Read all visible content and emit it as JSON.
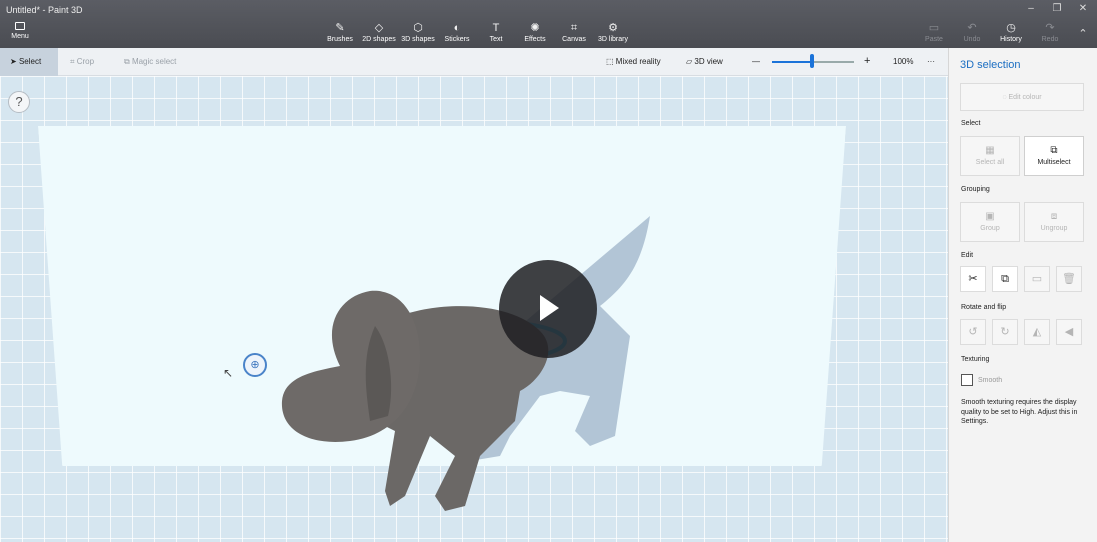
{
  "window": {
    "title": "Untitled* - Paint 3D",
    "minimize": "–",
    "maximize": "❐",
    "close": "✕"
  },
  "ribbon": {
    "menu": {
      "icon": "folder-icon",
      "label": "Menu"
    },
    "tools": [
      {
        "label": "Brushes",
        "icon": "✎"
      },
      {
        "label": "2D shapes",
        "icon": "◇"
      },
      {
        "label": "3D shapes",
        "icon": "⬡"
      },
      {
        "label": "Stickers",
        "icon": "◐"
      },
      {
        "label": "Text",
        "icon": "T"
      },
      {
        "label": "Effects",
        "icon": "✺"
      },
      {
        "label": "Canvas",
        "icon": "⌗"
      },
      {
        "label": "3D library",
        "icon": "⚙"
      }
    ],
    "right": [
      {
        "label": "Paste",
        "icon": "📋",
        "enabled": false
      },
      {
        "label": "Undo",
        "icon": "↶",
        "enabled": false
      },
      {
        "label": "History",
        "icon": "🕘",
        "enabled": true
      },
      {
        "label": "Redo",
        "icon": "↷",
        "enabled": false
      }
    ],
    "collapse_icon": "⌃"
  },
  "toolbar": {
    "select": "Select",
    "crop": "Crop",
    "magic": "Magic select",
    "mixed": "Mixed reality",
    "view3d": "3D view",
    "zoom_minus": "—",
    "zoom_plus": "+",
    "zoom": "100%",
    "more": "···"
  },
  "canvas": {
    "help": "?"
  },
  "panel": {
    "title": "3D selection",
    "edit_colour": "Edit colour",
    "select": {
      "heading": "Select",
      "select_all": "Select all",
      "multiselect": "Multiselect"
    },
    "grouping": {
      "heading": "Grouping",
      "group": "Group",
      "ungroup": "Ungroup"
    },
    "edit": {
      "heading": "Edit"
    },
    "rotate": {
      "heading": "Rotate and flip"
    },
    "texturing": {
      "heading": "Texturing",
      "smooth": "Smooth",
      "note": "Smooth texturing requires the display quality to be set to High. Adjust this in Settings."
    }
  },
  "colors": {
    "accent": "#1b6ec2",
    "ribbon": "#4f5157",
    "canvas": "#d6e6f0"
  }
}
